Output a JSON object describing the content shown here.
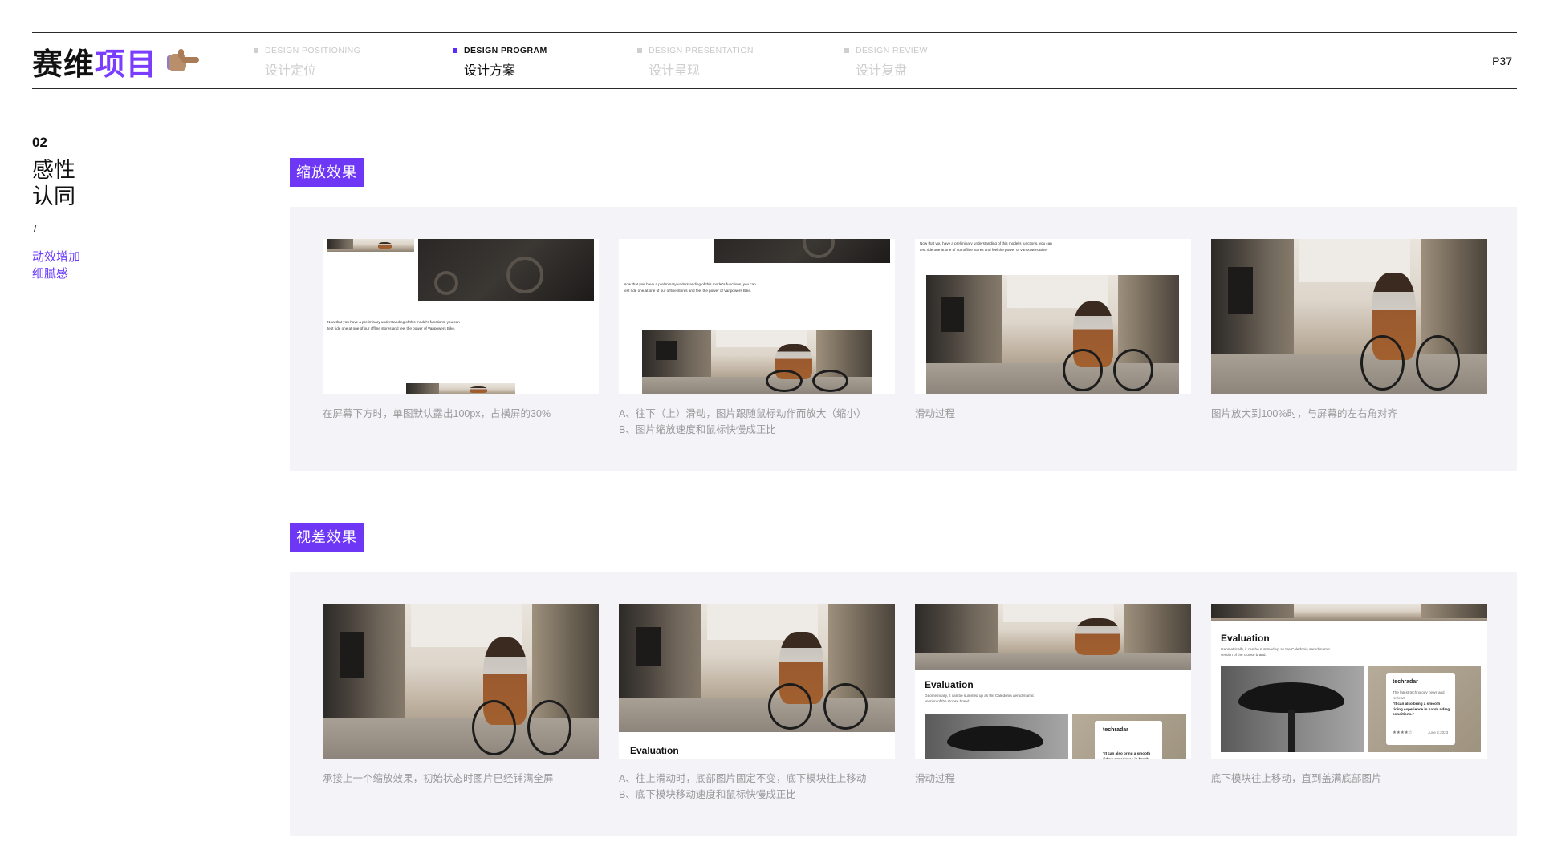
{
  "header": {
    "brand_dark": "赛维",
    "brand_accent": "项目",
    "page_number": "P37",
    "steps": [
      {
        "en": "DESIGN POSITIONING",
        "zh": "设计定位",
        "active": false
      },
      {
        "en": "DESIGN PROGRAM",
        "zh": "设计方案",
        "active": true
      },
      {
        "en": "DESIGN PRESENTATION",
        "zh": "设计呈现",
        "active": false
      },
      {
        "en": "DESIGN REVIEW",
        "zh": "设计复盘",
        "active": false
      }
    ]
  },
  "sidebar": {
    "number": "02",
    "title_line1": "感性",
    "title_line2": "认同",
    "slash": "/",
    "note_line1": "动效增加",
    "note_line2": "细腻感"
  },
  "zoom_section": {
    "tag": "缩放效果",
    "mock_text": "Now that you have a preliminary understanding of this model's functions, you can test ride one at one of our offline stores and feel the power of Vanpowers Bike.",
    "captions": [
      {
        "line1": "在屏幕下方时，单图默认露出100px，占横屏的30%",
        "line2": ""
      },
      {
        "line1": "A、往下（上）滑动，图片跟随鼠标动作而放大（缩小）",
        "line2": "B、图片缩放速度和鼠标快慢成正比"
      },
      {
        "line1": "滑动过程",
        "line2": ""
      },
      {
        "line1": "图片放大到100%时，与屏幕的左右角对齐",
        "line2": ""
      }
    ]
  },
  "parallax_section": {
    "tag": "视差效果",
    "eval_title": "Evaluation",
    "eval_sub": "Geometrically, it can be summed up as the Caledonia aerodynamic version of the Goose brand.",
    "review_brand": "techradar",
    "review_small": "The latest technology news and reviews",
    "review_quote": "“It can also bring a smooth riding experience in harsh riding conditions.”",
    "review_stars": "★★★★☆",
    "review_date": "June 2,2023",
    "captions": [
      {
        "line1": "承接上一个缩放效果，初始状态时图片已经铺满全屏",
        "line2": ""
      },
      {
        "line1": "A、往上滑动时，底部图片固定不变，底下模块往上移动",
        "line2": "B、底下模块移动速度和鼠标快慢成正比"
      },
      {
        "line1": "滑动过程",
        "line2": ""
      },
      {
        "line1": "底下模块往上移动，直到盖满底部图片",
        "line2": ""
      }
    ]
  },
  "colors": {
    "accent": "#6e37f6",
    "panel_bg": "#f4f4f8",
    "caption": "#9a9a9a"
  },
  "icons": [
    "pointing-hand-icon",
    "step-square-icon"
  ]
}
